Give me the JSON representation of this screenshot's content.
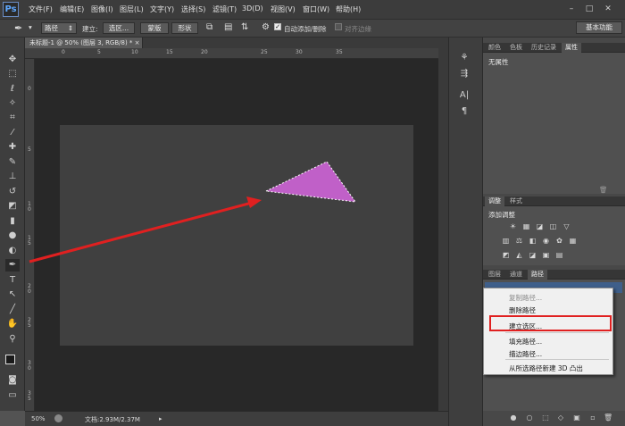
{
  "app": {
    "logo": "Ps"
  },
  "menu": [
    "文件(F)",
    "编辑(E)",
    "图像(I)",
    "图层(L)",
    "文字(Y)",
    "选择(S)",
    "滤镜(T)",
    "3D(D)",
    "视图(V)",
    "窗口(W)",
    "帮助(H)"
  ],
  "window_controls": [
    "–",
    "□",
    "✕"
  ],
  "options_bar": {
    "mode_value": "路径",
    "make_label": "建立:",
    "selection_btn": "选区...",
    "mask_btn": "蒙版",
    "shape_btn": "形状",
    "auto_add_delete": "自动添加/删除",
    "align_edges": "对齐边缘",
    "workspace": "基本功能"
  },
  "document": {
    "tab_title": "未标题-1 @ 50% (图层 3, RGB/8) *",
    "close": "×",
    "zoom": "50%",
    "doc_info": "文档:2.93M/2.37M",
    "ruler_top": [
      "0",
      "5",
      "10",
      "15",
      "20",
      "25",
      "30",
      "35"
    ],
    "ruler_left": [
      "0",
      "5",
      "1\n0",
      "1\n5",
      "2\n0",
      "2\n5",
      "3\n0",
      "3\n5"
    ]
  },
  "colors": {
    "foreground": "#1a1a1a",
    "background": "#c060c8",
    "selection_fill": "#c060c8",
    "arrow": "#e02020",
    "highlight": "#e02020"
  },
  "panels": {
    "top_tabs": [
      "颜色",
      "色板",
      "历史记录",
      "属性"
    ],
    "properties_text": "无属性",
    "adjust_tabs": [
      "调整",
      "样式"
    ],
    "adjust_title": "添加调整",
    "layers_tabs": [
      "图层",
      "通道",
      "路径"
    ]
  },
  "context_menu": {
    "items": [
      {
        "label": "复制路径...",
        "disabled": true
      },
      {
        "label": "删除路径",
        "disabled": false
      },
      {
        "label": "建立选区...",
        "disabled": false,
        "highlighted": true
      },
      {
        "label": "填充路径...",
        "disabled": false
      },
      {
        "label": "描边路径...",
        "disabled": false
      },
      {
        "label": "从所选路径新建 3D 凸出",
        "disabled": false
      }
    ]
  }
}
